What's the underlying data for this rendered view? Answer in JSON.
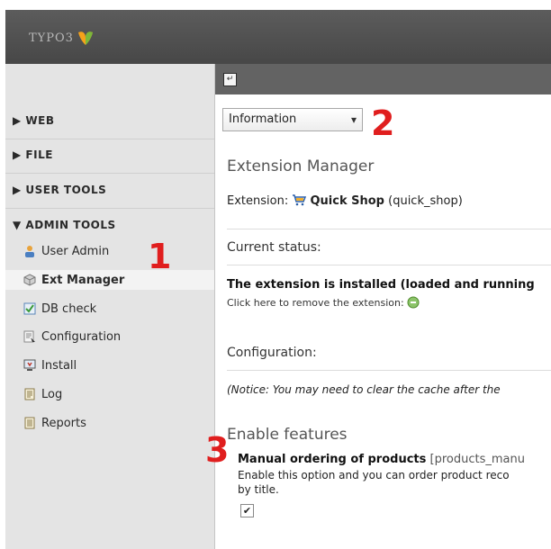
{
  "header": {
    "logo_text": "TYPO3"
  },
  "sidebar": {
    "modules": [
      {
        "label": "▶ WEB"
      },
      {
        "label": "▶ FILE"
      },
      {
        "label": "▶ USER TOOLS"
      },
      {
        "label": "▼ ADMIN TOOLS"
      }
    ],
    "admin_items": [
      {
        "label": "User Admin",
        "icon": "user-admin-icon"
      },
      {
        "label": "Ext Manager",
        "icon": "ext-manager-icon",
        "active": true
      },
      {
        "label": "DB check",
        "icon": "db-check-icon"
      },
      {
        "label": "Configuration",
        "icon": "configuration-icon"
      },
      {
        "label": "Install",
        "icon": "install-icon"
      },
      {
        "label": "Log",
        "icon": "log-icon"
      },
      {
        "label": "Reports",
        "icon": "reports-icon"
      }
    ]
  },
  "content": {
    "select_value": "Information",
    "select_arrow": "▾",
    "title": "Extension Manager",
    "extension_prefix": "Extension: ",
    "extension_name": "Quick Shop",
    "extension_key": " (quick_shop)",
    "current_status_heading": "Current status:",
    "status_text": "The extension is installed (loaded and running",
    "remove_text": "Click here to remove the extension: ",
    "configuration_heading": "Configuration:",
    "notice": "(Notice: You may need to clear the cache after the",
    "features_heading": "Enable features",
    "feature_title": "Manual ordering of products",
    "feature_key": " [products_manu",
    "feature_desc_1": "Enable this option and you can order product reco",
    "feature_desc_2": "by title.",
    "checkbox_mark": "✔"
  },
  "annotations": {
    "marker_1": "1",
    "marker_2": "2",
    "marker_3": "3",
    "color": "#e01e1e"
  }
}
